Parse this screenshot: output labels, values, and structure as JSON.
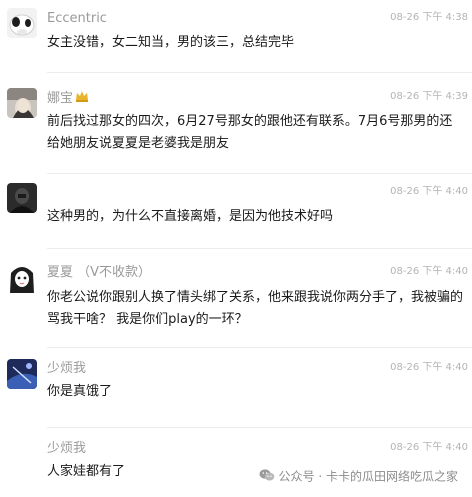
{
  "comments": [
    {
      "name": "Eccentric",
      "time": "08-26 下午 4:38",
      "content": "女主没错，女二知当，男的该三，总结完毕"
    },
    {
      "name": "娜宝",
      "time": "08-26 下午 4:39",
      "content": "前后找过那女的四次，6月27号那女的跟他还有联系。7月6号那男的还给她朋友说夏夏是老婆我是朋友"
    },
    {
      "name": "",
      "time": "08-26 下午 4:40",
      "content": "这种男的，为什么不直接离婚，是因为他技术好吗"
    },
    {
      "name": "夏夏 （V不收款）",
      "time": "08-26 下午 4:40",
      "content": "你老公说你跟别人换了情头绑了关系，他来跟我说你两分手了，我被骗的骂我干啥？ 我是你们play的一环？"
    },
    {
      "name": "少烦我",
      "time": "08-26 下午 4:40",
      "content": "你是真饿了"
    },
    {
      "name": "少烦我",
      "time": "08-26 下午 4:40",
      "content": "人家娃都有了"
    }
  ],
  "watermark": {
    "text": "公众号 · 卡卡的瓜田网络吃瓜之家",
    "icon": "wechat-icon"
  },
  "colors": {
    "name": "#9a9a9a",
    "time": "#b4b4b4",
    "content": "#1a1a1a",
    "divider": "#ececec"
  }
}
